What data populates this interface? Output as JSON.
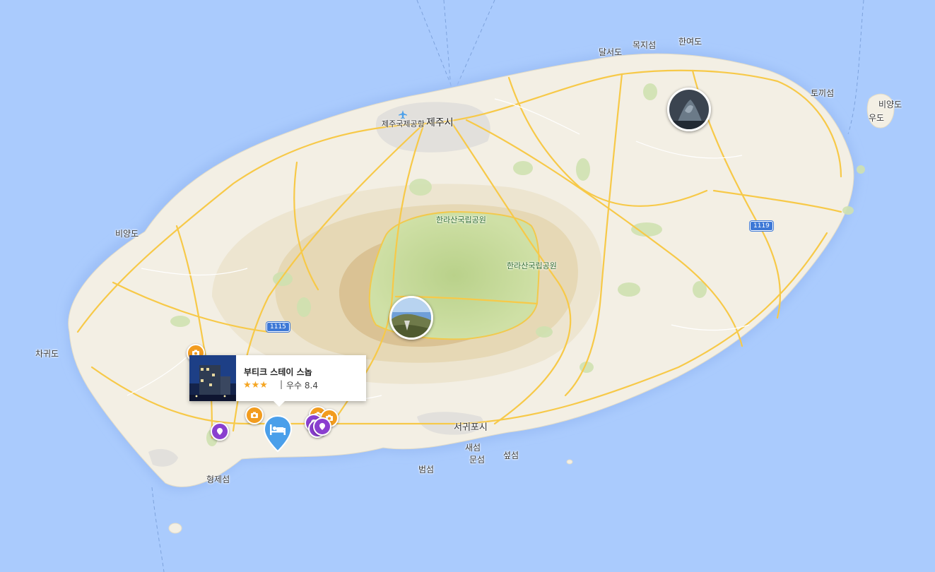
{
  "labels": {
    "jeju_city": "제주시",
    "airport": "제주국제공항",
    "seogwipo": "서귀포시",
    "park_north": "한라산국립공원",
    "park_east": "한라산국립공원",
    "dalseodo": "달서도",
    "mokjiseom": "목지섬",
    "hanyeodo": "한여도",
    "tokkiseom": "토끼섬",
    "biyangdo_east": "비양도",
    "udo": "우도",
    "biyangdo_west": "비양도",
    "chagwido": "차귀도",
    "hyeongjeseom": "형제섬",
    "saeseom": "새섬",
    "munseom": "문섬",
    "seopseom": "섶섬",
    "beomseom": "범섬"
  },
  "road_shields": {
    "r1115": "1115",
    "r1119": "1119"
  },
  "popup": {
    "hotel_name": "부티크 스테이 스놉",
    "stars": "★★★",
    "separator": "|",
    "rating": "우수 8.4"
  },
  "colors": {
    "sea": "#aacbfd",
    "land": "#f3efe4",
    "park": "#c6d99a",
    "road": "#f7c948",
    "hotel_pin": "#4a9fea",
    "attraction_pin": "#8a3fcf",
    "camera_pin": "#f29c1f"
  },
  "icons": {
    "hotel": "bed-icon",
    "attraction": "landmark-pin-icon",
    "camera": "camera-icon"
  }
}
